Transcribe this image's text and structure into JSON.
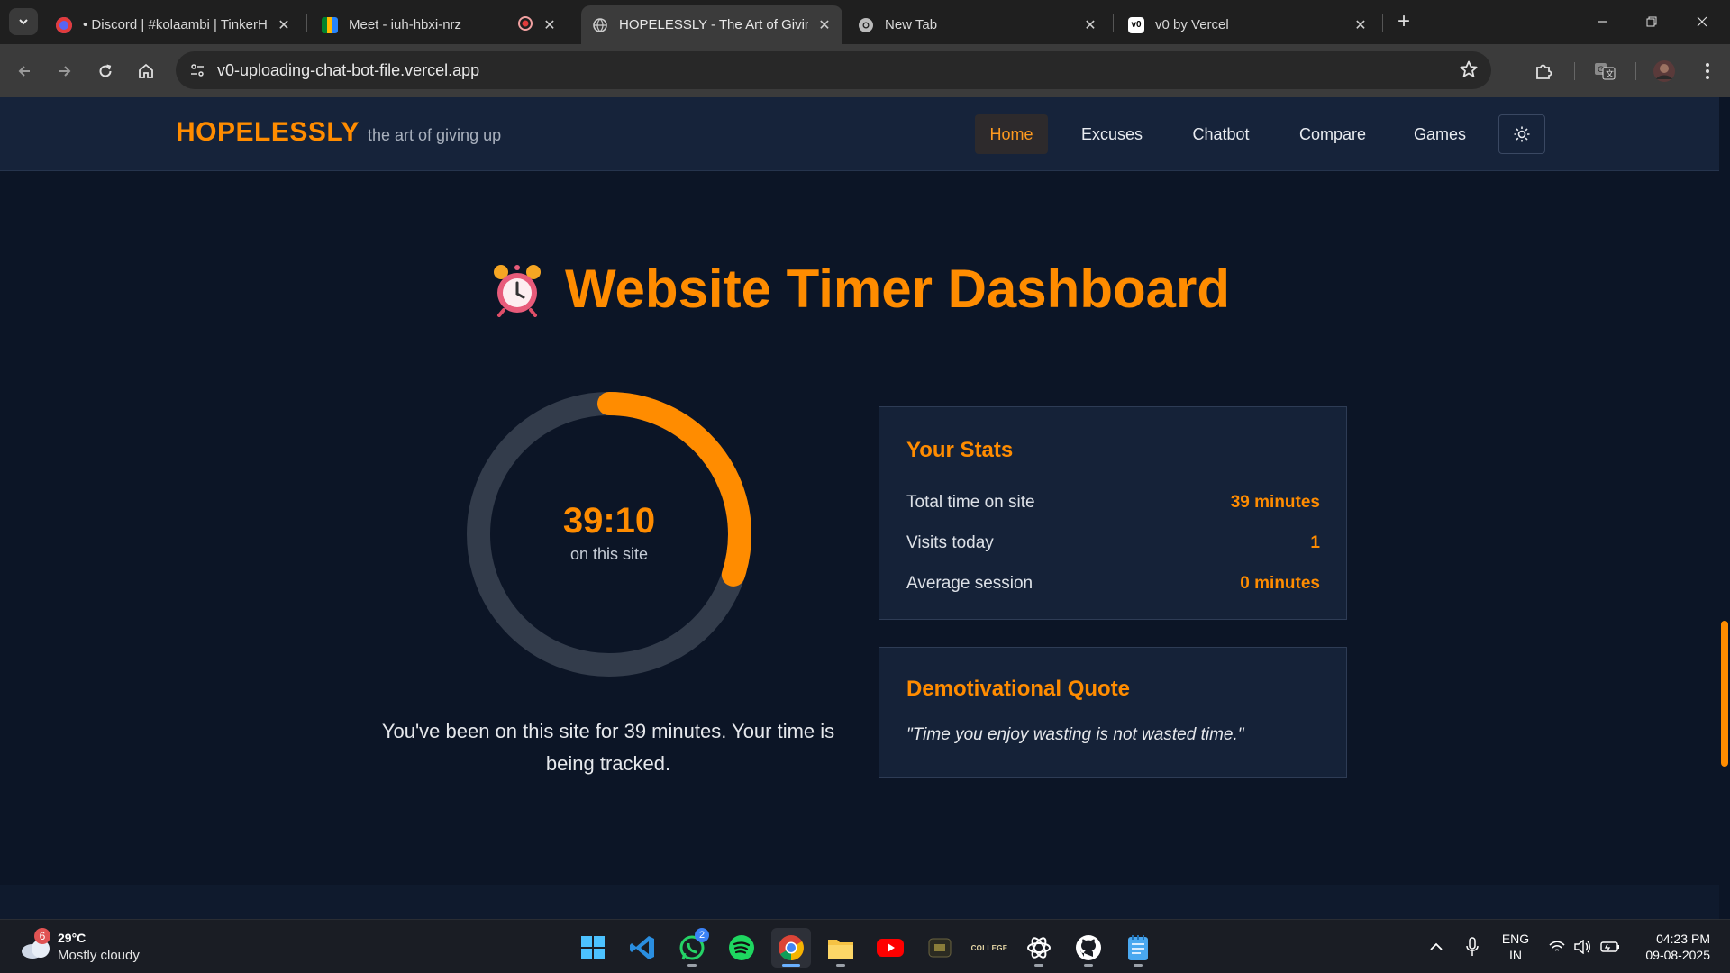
{
  "browser": {
    "tabs": [
      {
        "title": "• Discord | #kolaambi | TinkerHub",
        "active": false
      },
      {
        "title": "Meet - iuh-hbxi-nrz",
        "active": false
      },
      {
        "title": "HOPELESSLY - The Art of Giving Up",
        "active": true
      },
      {
        "title": "New Tab",
        "active": false
      },
      {
        "title": "v0 by Vercel",
        "active": false
      }
    ],
    "url": "v0-uploading-chat-bot-file.vercel.app"
  },
  "site": {
    "brand": "HOPELESSLY",
    "tagline": "the art of giving up",
    "nav": [
      "Home",
      "Excuses",
      "Chatbot",
      "Compare",
      "Games"
    ],
    "active_nav": "Home"
  },
  "dashboard": {
    "title": "Website Timer Dashboard",
    "timer": {
      "display": "39:10",
      "sublabel": "on this site",
      "progress_fraction": 0.3
    },
    "caption": "You've been on this site for 39 minutes. Your time is being tracked.",
    "stats": {
      "heading": "Your Stats",
      "rows": [
        {
          "label": "Total time on site",
          "value": "39 minutes"
        },
        {
          "label": "Visits today",
          "value": "1"
        },
        {
          "label": "Average session",
          "value": "0 minutes"
        }
      ]
    },
    "quote": {
      "heading": "Demotivational Quote",
      "text": "\"Time you enjoy wasting is not wasted time.\""
    }
  },
  "taskbar": {
    "weather": {
      "temp": "29°C",
      "condition": "Mostly cloudy",
      "badge": "6"
    },
    "whatsapp_badge": "2",
    "college_label": "COLLEGE",
    "language": {
      "line1": "ENG",
      "line2": "IN"
    },
    "clock": {
      "time": "04:23 PM",
      "date": "09-08-2025"
    }
  },
  "colors": {
    "accent": "#ff8c00",
    "background": "#0c1526",
    "card": "#152238",
    "ring_track": "#333c4b"
  }
}
